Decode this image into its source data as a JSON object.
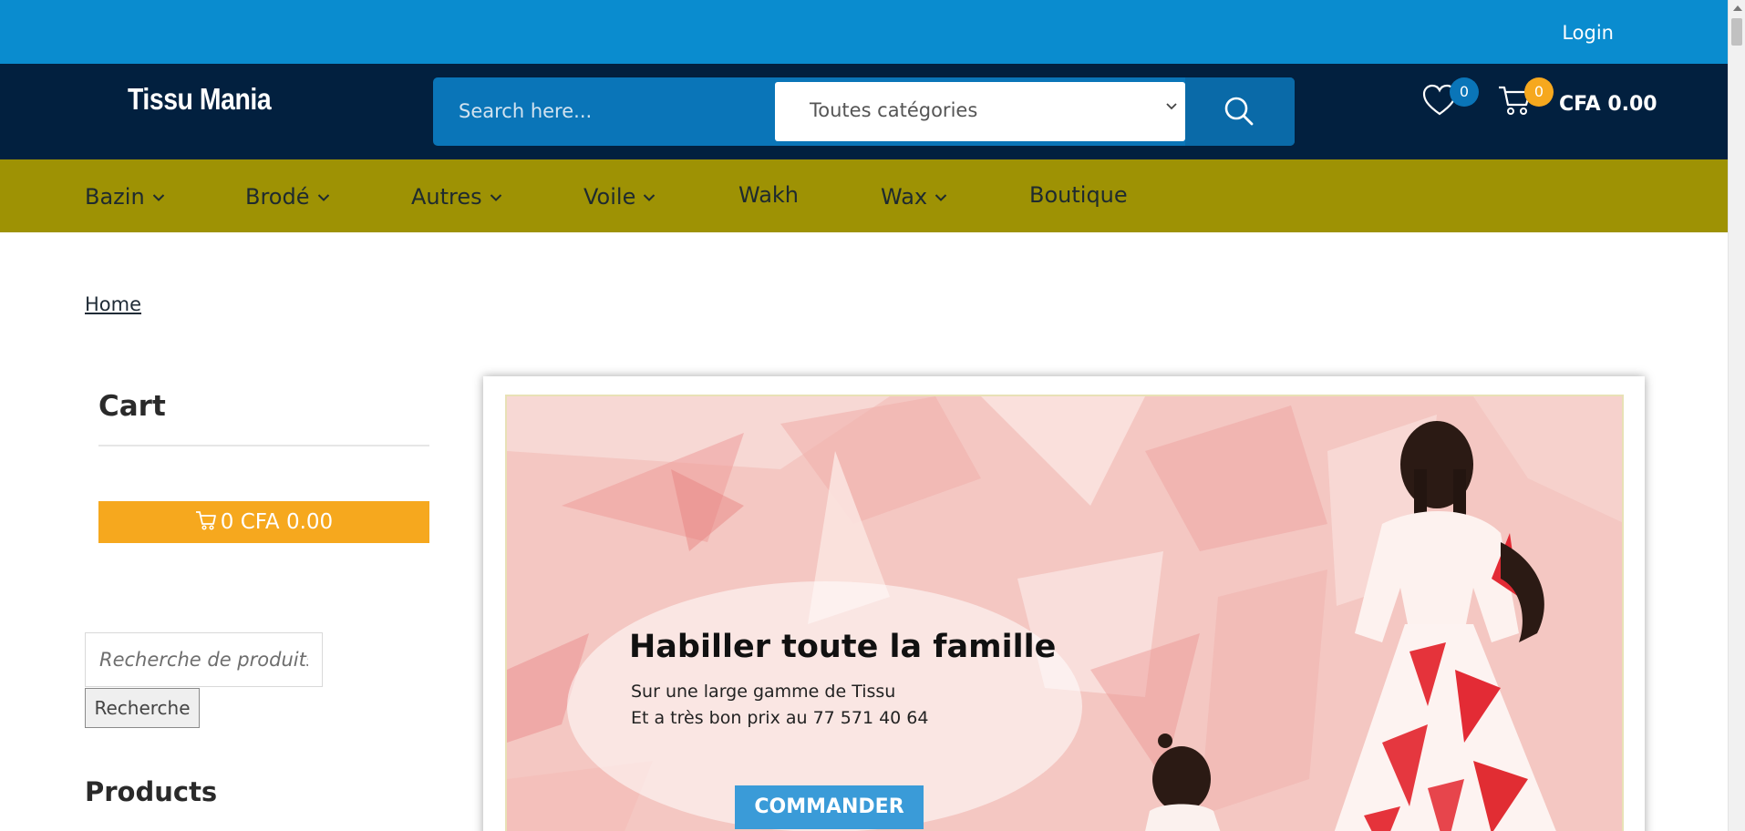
{
  "topbar": {
    "login_label": "Login"
  },
  "header": {
    "logo": "Tissu Mania",
    "search_placeholder": "Search here...",
    "category_selected": "Toutes catégories",
    "wishlist_count": "0",
    "cart_count": "0",
    "cart_total": "CFA 0.00"
  },
  "nav": {
    "items": [
      {
        "label": "Bazin",
        "has_dropdown": true
      },
      {
        "label": "Brodé",
        "has_dropdown": true
      },
      {
        "label": "Autres",
        "has_dropdown": true
      },
      {
        "label": "Voile",
        "has_dropdown": true
      },
      {
        "label": "Wakh",
        "has_dropdown": false
      },
      {
        "label": "Wax",
        "has_dropdown": true
      },
      {
        "label": "Boutique",
        "has_dropdown": false
      }
    ]
  },
  "breadcrumb": {
    "home": "Home"
  },
  "sidebar": {
    "cart_title": "Cart",
    "cart_button": "0 CFA 0.00",
    "product_search_placeholder": "Recherche de produits…",
    "product_search_button": "Recherche",
    "products_title": "Products"
  },
  "hero": {
    "title": "Habiller toute la famille",
    "line1": "Sur une large gamme de Tissu",
    "line2": "Et a très bon prix au 77 571 40 64",
    "cta": "COMMANDER"
  },
  "colors": {
    "topbar": "#0a8ccf",
    "header": "#02203f",
    "nav": "#9e9204",
    "accent_orange": "#f6a81e",
    "cta_blue": "#3a9bd8"
  },
  "icons": [
    "heart-icon",
    "cart-icon",
    "search-icon",
    "chevron-down-icon"
  ]
}
